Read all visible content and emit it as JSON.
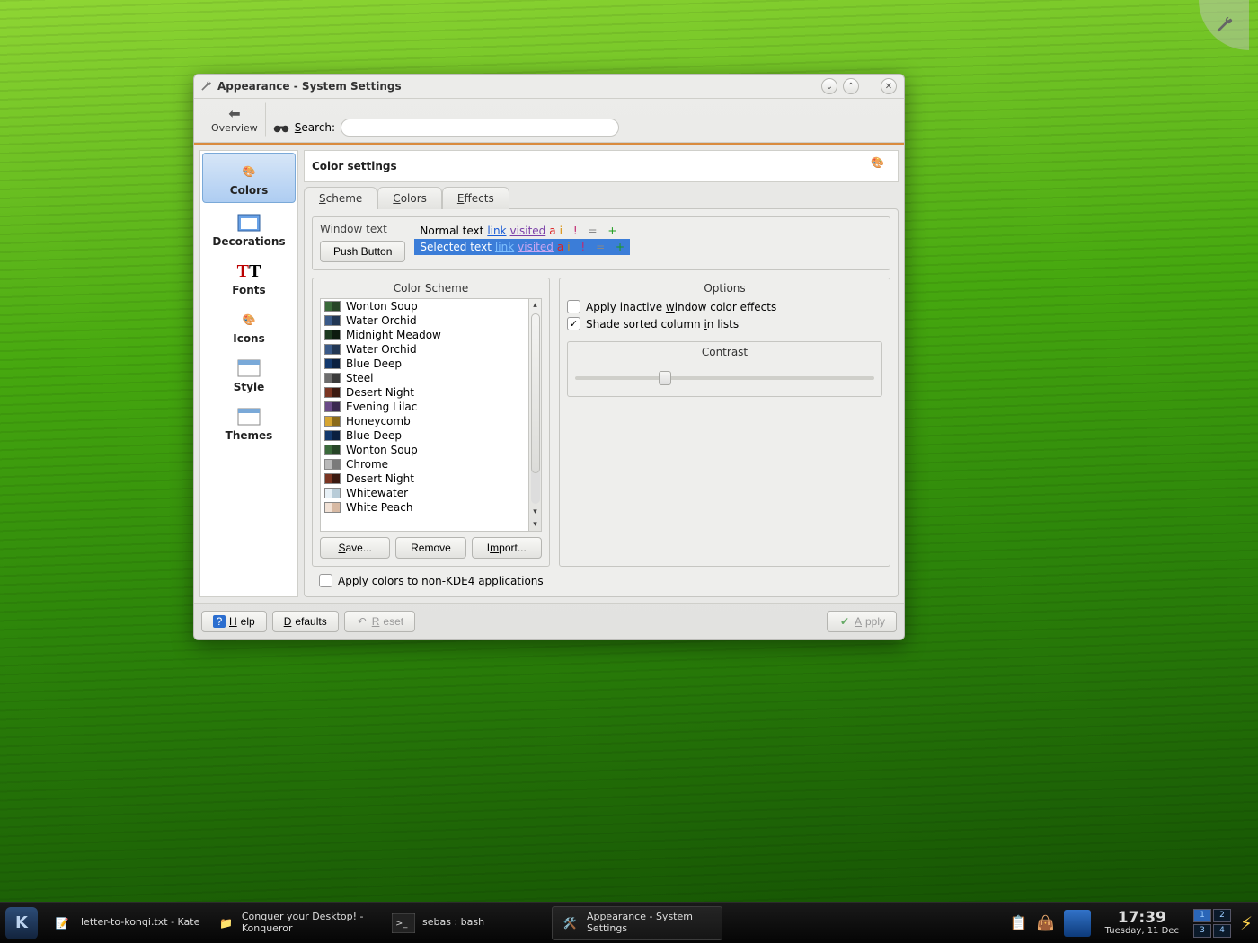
{
  "window": {
    "title": "Appearance - System Settings"
  },
  "toolbar": {
    "overview": "Overview",
    "search_label": "Search:",
    "search_value": ""
  },
  "sidebar": {
    "items": [
      "Colors",
      "Decorations",
      "Fonts",
      "Icons",
      "Style",
      "Themes"
    ],
    "selected": 0
  },
  "page": {
    "title": "Color settings",
    "tabs": [
      "Scheme",
      "Colors",
      "Effects"
    ],
    "active_tab": 0,
    "preview": {
      "window_text_label": "Window text",
      "push_button_label": "Push Button",
      "normal_text": "Normal text",
      "selected_text": "Selected text",
      "link": "link",
      "visited": "visited"
    },
    "color_scheme": {
      "title": "Color Scheme",
      "items": [
        {
          "name": "Wonton Soup",
          "sw": [
            "#3a6a3a",
            "#274527"
          ]
        },
        {
          "name": "Water Orchid",
          "sw": [
            "#3a5a88",
            "#223754"
          ]
        },
        {
          "name": "Midnight Meadow",
          "sw": [
            "#1d3a20",
            "#0d1b0f"
          ]
        },
        {
          "name": "Water Orchid",
          "sw": [
            "#3a5a88",
            "#223754"
          ]
        },
        {
          "name": "Blue Deep",
          "sw": [
            "#13396d",
            "#0a2040"
          ]
        },
        {
          "name": "Steel",
          "sw": [
            "#6d6d6d",
            "#3b3b3b"
          ]
        },
        {
          "name": "Desert Night",
          "sw": [
            "#7a3522",
            "#3b1a11"
          ]
        },
        {
          "name": "Evening Lilac",
          "sw": [
            "#6a4a88",
            "#3a2850"
          ]
        },
        {
          "name": "Honeycomb",
          "sw": [
            "#d6a531",
            "#8a6a1a"
          ]
        },
        {
          "name": "Blue Deep",
          "sw": [
            "#13396d",
            "#0a2040"
          ]
        },
        {
          "name": "Wonton Soup",
          "sw": [
            "#3a6a3a",
            "#274527"
          ]
        },
        {
          "name": "Chrome",
          "sw": [
            "#b9b9b9",
            "#7a7a7a"
          ]
        },
        {
          "name": "Desert Night",
          "sw": [
            "#7a3522",
            "#3b1a11"
          ]
        },
        {
          "name": "Whitewater",
          "sw": [
            "#e8f1f7",
            "#b8ccd8"
          ]
        },
        {
          "name": "White Peach",
          "sw": [
            "#f2e2d6",
            "#d7b9a3"
          ]
        }
      ],
      "buttons": {
        "save": "Save...",
        "remove": "Remove",
        "import": "Import..."
      }
    },
    "options": {
      "title": "Options",
      "apply_inactive": "Apply inactive window color effects",
      "shade_sorted": "Shade sorted column in lists",
      "apply_inactive_checked": false,
      "shade_sorted_checked": true,
      "contrast_title": "Contrast"
    },
    "apply_non_kde": "Apply colors to non-KDE4 applications",
    "apply_non_kde_checked": false
  },
  "footer": {
    "help": "Help",
    "defaults": "Defaults",
    "reset": "Reset",
    "apply": "Apply"
  },
  "panel": {
    "tasks": [
      {
        "title": "letter-to-konqi.txt - Kate"
      },
      {
        "title": "Conquer your Desktop! - Konqueror"
      },
      {
        "title": "sebas : bash"
      },
      {
        "title": "Appearance - System Settings"
      }
    ],
    "clock": {
      "time": "17:39",
      "date": "Tuesday, 11 Dec"
    },
    "pager": [
      "1",
      "2",
      "3",
      "4"
    ],
    "pager_current": 0
  }
}
